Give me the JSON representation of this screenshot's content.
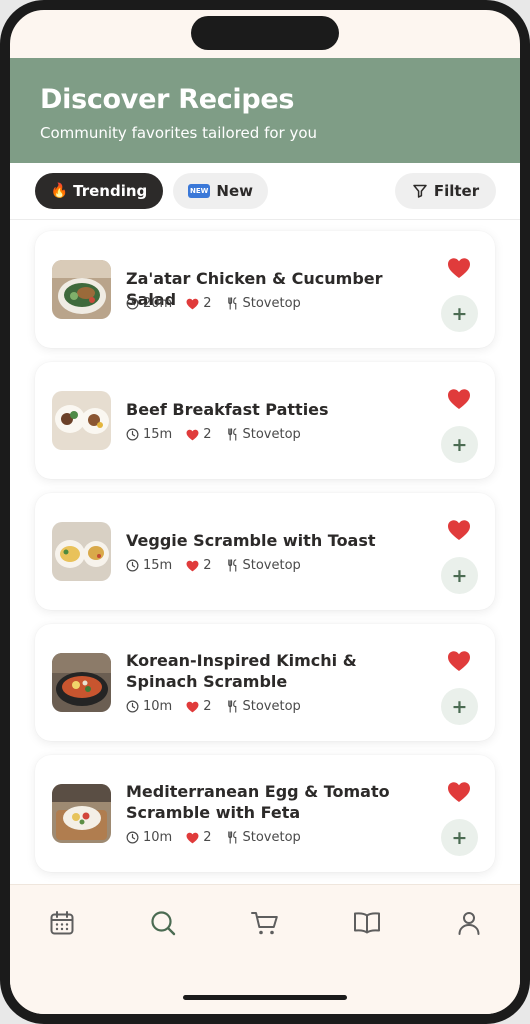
{
  "header": {
    "title": "Discover Recipes",
    "subtitle": "Community favorites tailored for you"
  },
  "filters": {
    "trending_icon": "🔥",
    "trending_label": "Trending",
    "new_badge": "NEW",
    "new_label": "New",
    "filter_label": "Filter"
  },
  "recipes": [
    {
      "title": "Za'atar Chicken & Cucumber Salad",
      "time": "20m",
      "likes": "2",
      "method": "Stovetop"
    },
    {
      "title": "Beef Breakfast Patties",
      "time": "15m",
      "likes": "2",
      "method": "Stovetop"
    },
    {
      "title": "Veggie Scramble with Toast",
      "time": "15m",
      "likes": "2",
      "method": "Stovetop"
    },
    {
      "title": "Korean-Inspired Kimchi & Spinach Scramble",
      "time": "10m",
      "likes": "2",
      "method": "Stovetop"
    },
    {
      "title": "Mediterranean Egg & Tomato Scramble with Feta",
      "time": "10m",
      "likes": "2",
      "method": "Stovetop"
    }
  ],
  "add_label": "+",
  "nav": [
    "calendar-icon",
    "search-icon",
    "cart-icon",
    "book-icon",
    "profile-icon"
  ],
  "colors": {
    "header_bg": "#7f9d86",
    "accent_green": "#4b6b52",
    "heart_red": "#e03b3b",
    "dark_chip": "#2c2a29",
    "background": "#fdf6f0"
  }
}
